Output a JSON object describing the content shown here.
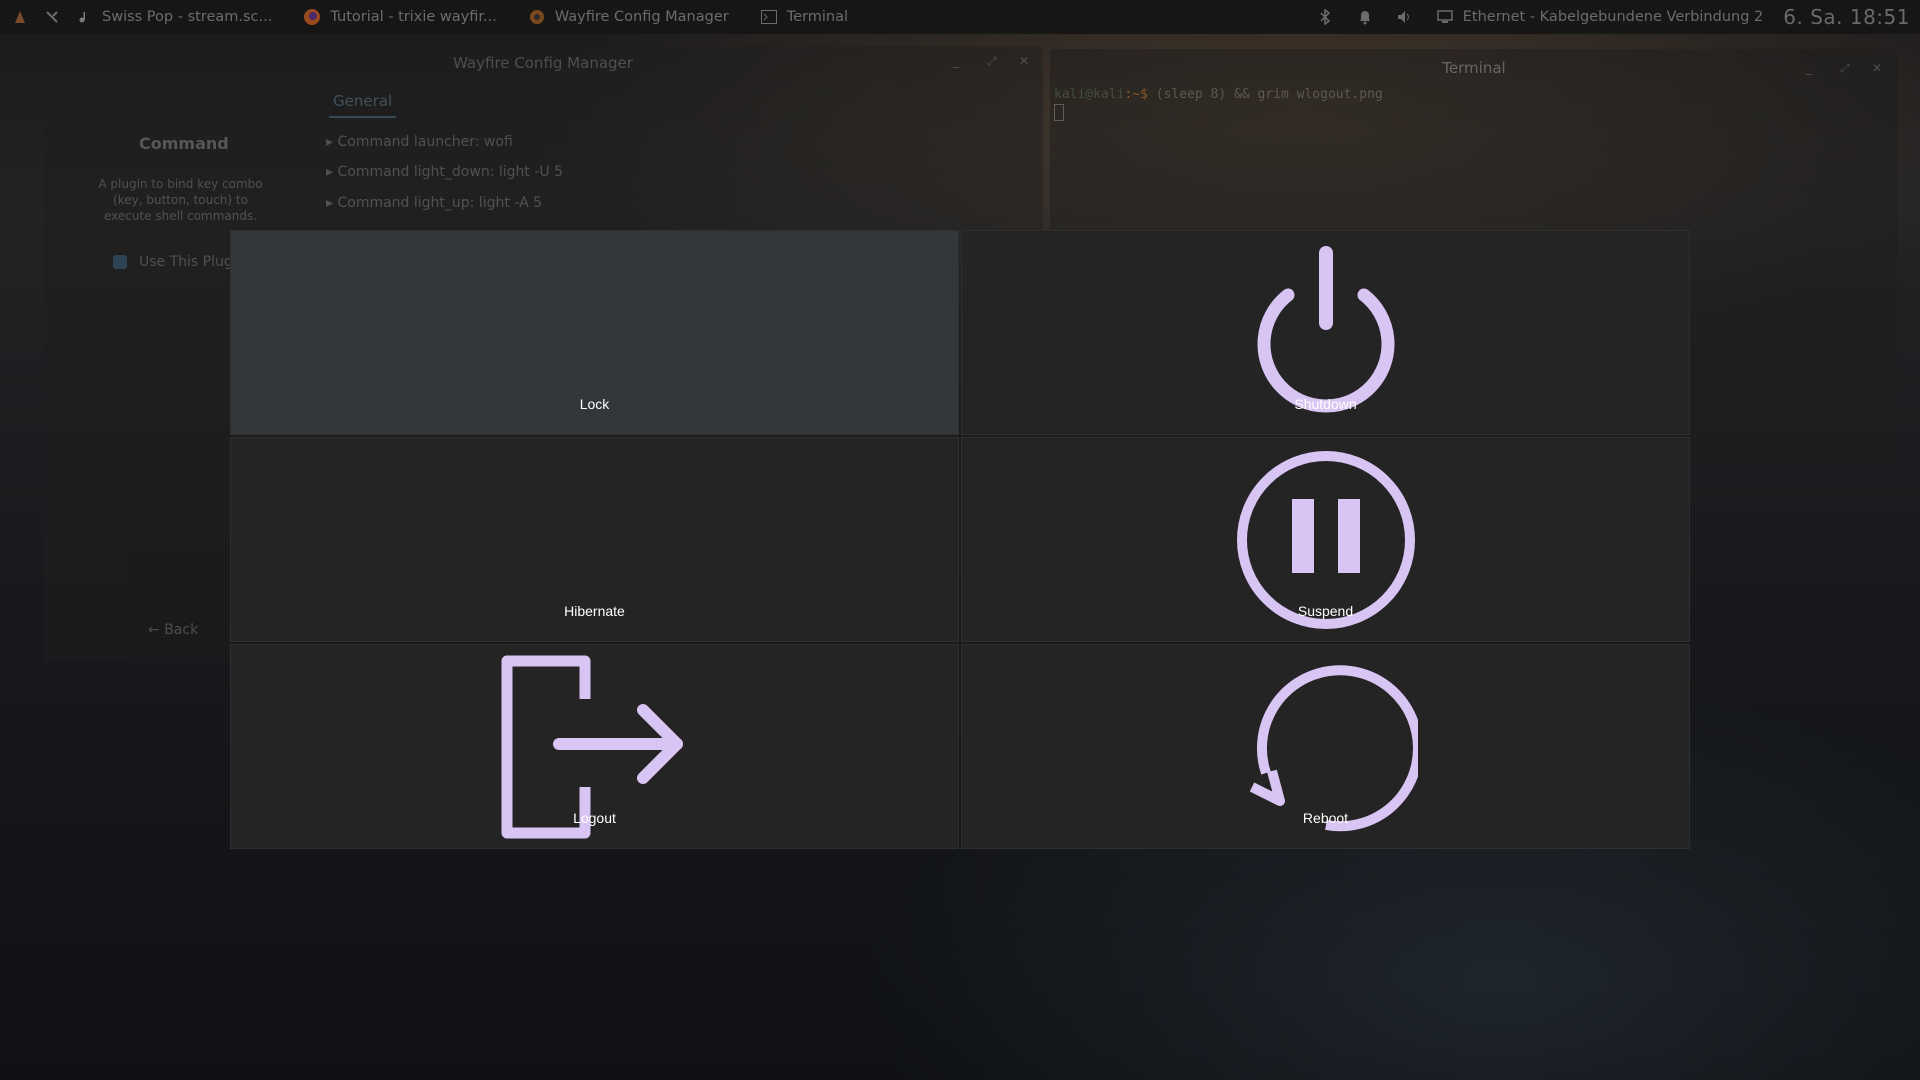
{
  "topbar": {
    "tasks": [
      {
        "icon": "music-icon",
        "label": "Swiss Pop - stream.sc..."
      },
      {
        "icon": "firefox-icon",
        "label": "Tutorial - trixie wayfir..."
      },
      {
        "icon": "wayfire-icon",
        "label": "Wayfire Config Manager"
      },
      {
        "icon": "terminal-icon",
        "label": "Terminal"
      }
    ],
    "network": "Ethernet - Kabelgebundene Verbindung 2",
    "clock": "6. Sa. 18:51"
  },
  "config_window": {
    "title": "Wayfire Config Manager",
    "tab": "General",
    "plugin_title": "Command",
    "plugin_description": "A plugin to bind key combo (key, button, touch) to execute shell commands.",
    "use_plugin_label": "Use This Plugi",
    "options": [
      "Command launcher: wofi",
      "Command light_down: light -U 5",
      "Command light_up: light -A 5"
    ],
    "back_label": "Back"
  },
  "terminal_window": {
    "title": "Terminal",
    "prompt_user": "kali@kali",
    "prompt_path": ":~$",
    "command": " (sleep 8) && grim wlogout.png"
  },
  "wlogout": {
    "accent_color": "#d9c5f3",
    "buttons": [
      {
        "label": "Lock",
        "icon": "lock-icon",
        "highlighted": true
      },
      {
        "label": "Shutdown",
        "icon": "power-icon",
        "highlighted": false
      },
      {
        "label": "Hibernate",
        "icon": "hibernate-icon",
        "highlighted": false
      },
      {
        "label": "Suspend",
        "icon": "pause-icon",
        "highlighted": false
      },
      {
        "label": "Logout",
        "icon": "logout-icon",
        "highlighted": false
      },
      {
        "label": "Reboot",
        "icon": "reboot-icon",
        "highlighted": false
      }
    ]
  }
}
